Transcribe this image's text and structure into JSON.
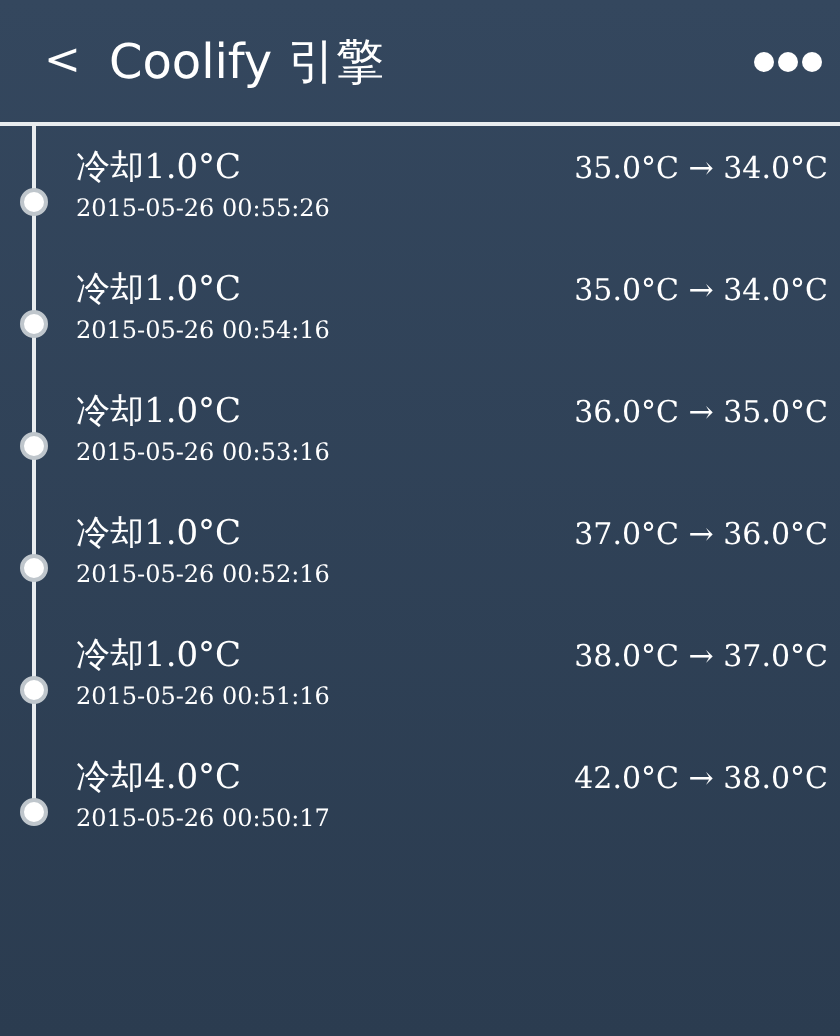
{
  "header": {
    "back": "<",
    "title": "Coolify 引擎"
  },
  "entries": [
    {
      "title": "冷却1.0°C",
      "time": "2015-05-26 00:55:26",
      "change": "35.0°C → 34.0°C"
    },
    {
      "title": "冷却1.0°C",
      "time": "2015-05-26 00:54:16",
      "change": "35.0°C → 34.0°C"
    },
    {
      "title": "冷却1.0°C",
      "time": "2015-05-26 00:53:16",
      "change": "36.0°C → 35.0°C"
    },
    {
      "title": "冷却1.0°C",
      "time": "2015-05-26 00:52:16",
      "change": "37.0°C → 36.0°C"
    },
    {
      "title": "冷却1.0°C",
      "time": "2015-05-26 00:51:16",
      "change": "38.0°C → 37.0°C"
    },
    {
      "title": "冷却4.0°C",
      "time": "2015-05-26 00:50:17",
      "change": "42.0°C → 38.0°C"
    }
  ]
}
